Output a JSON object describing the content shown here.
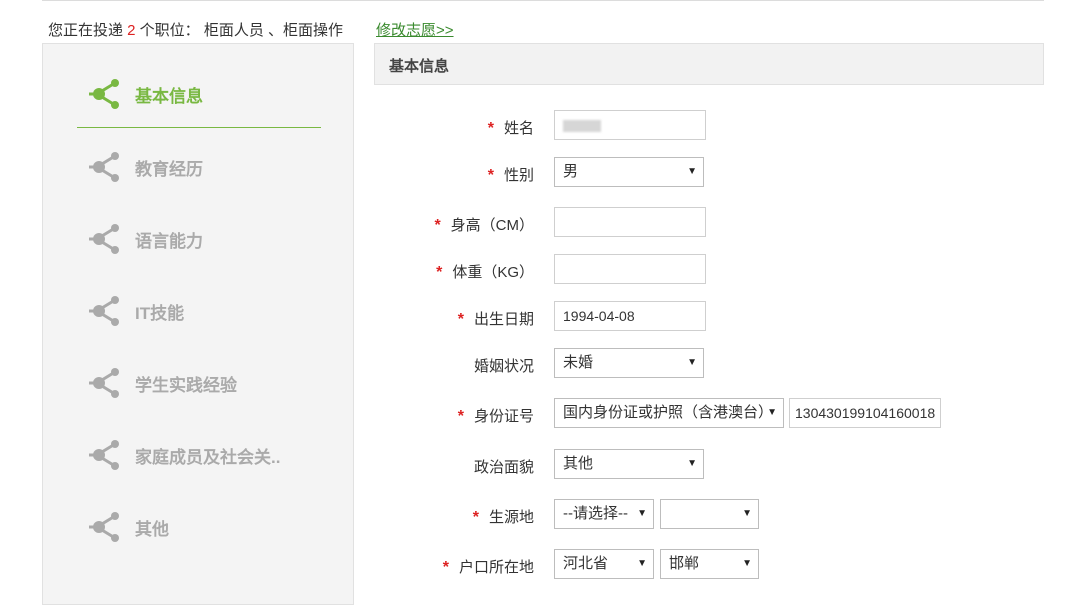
{
  "header": {
    "apply_prefix": "您正在投递 ",
    "apply_count": "2",
    "apply_suffix": " 个职位：  柜面人员 、柜面操作",
    "modify_link": "修改志愿>>"
  },
  "sidebar": {
    "items": [
      {
        "label": "基本信息",
        "active": true
      },
      {
        "label": "教育经历",
        "active": false
      },
      {
        "label": "语言能力",
        "active": false
      },
      {
        "label": "IT技能",
        "active": false
      },
      {
        "label": "学生实践经验",
        "active": false
      },
      {
        "label": "家庭成员及社会关..",
        "active": false
      },
      {
        "label": "其他",
        "active": false
      }
    ]
  },
  "section": {
    "title": "基本信息"
  },
  "form": {
    "name": {
      "label": "姓名",
      "required": "*",
      "value": ""
    },
    "gender": {
      "label": "性别",
      "required": "*",
      "value": "男"
    },
    "height": {
      "label": "身高（CM）",
      "required": "*",
      "value": ""
    },
    "weight": {
      "label": "体重（KG）",
      "required": "*",
      "value": ""
    },
    "birthdate": {
      "label": "出生日期",
      "required": "*",
      "value": "1994-04-08"
    },
    "marital": {
      "label": "婚姻状况",
      "value": "未婚"
    },
    "id": {
      "label": "身份证号",
      "required": "*",
      "type_value": "国内身份证或护照（含港澳台）",
      "number": "130430199104160018"
    },
    "political": {
      "label": "政治面貌",
      "value": "其他"
    },
    "origin": {
      "label": "生源地",
      "required": "*",
      "province": "--请选择--",
      "city": ""
    },
    "hukou": {
      "label": "户口所在地",
      "required": "*",
      "province": "河北省",
      "city": "邯郸"
    }
  },
  "colors": {
    "accent": "#79b842",
    "required": "#dd2222",
    "inactive": "#aaaaaa",
    "link": "#3a8a2e"
  }
}
